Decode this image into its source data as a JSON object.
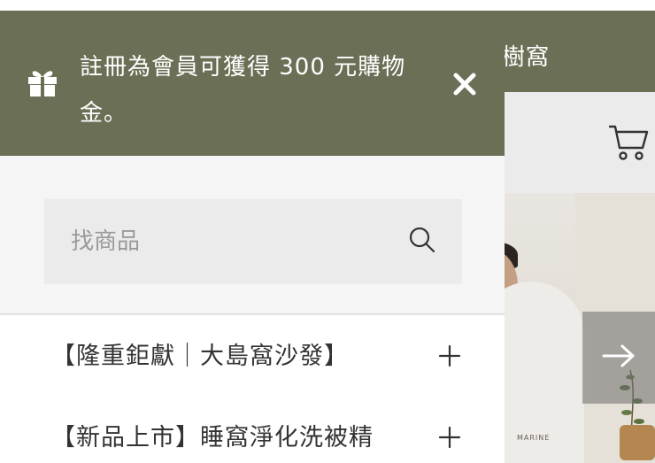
{
  "promo": {
    "message": "註冊為會員可獲得 300 元購物金。",
    "icon": "gift-icon",
    "close_icon": "close-icon",
    "bg_color": "#6b6f55"
  },
  "search": {
    "placeholder": "找商品",
    "icon": "search-icon"
  },
  "menu": {
    "items": [
      {
        "label": "【隆重鉅獻｜大島窩沙發】",
        "icon": "plus-icon"
      },
      {
        "label": "【新品上市】睡窩淨化洗被精",
        "icon": "plus-icon"
      }
    ]
  },
  "background": {
    "brand_fragment": "的樹窩",
    "shirt_text": "MARINE",
    "cart_icon": "cart-icon",
    "arrow_icon": "arrow-right-icon"
  }
}
